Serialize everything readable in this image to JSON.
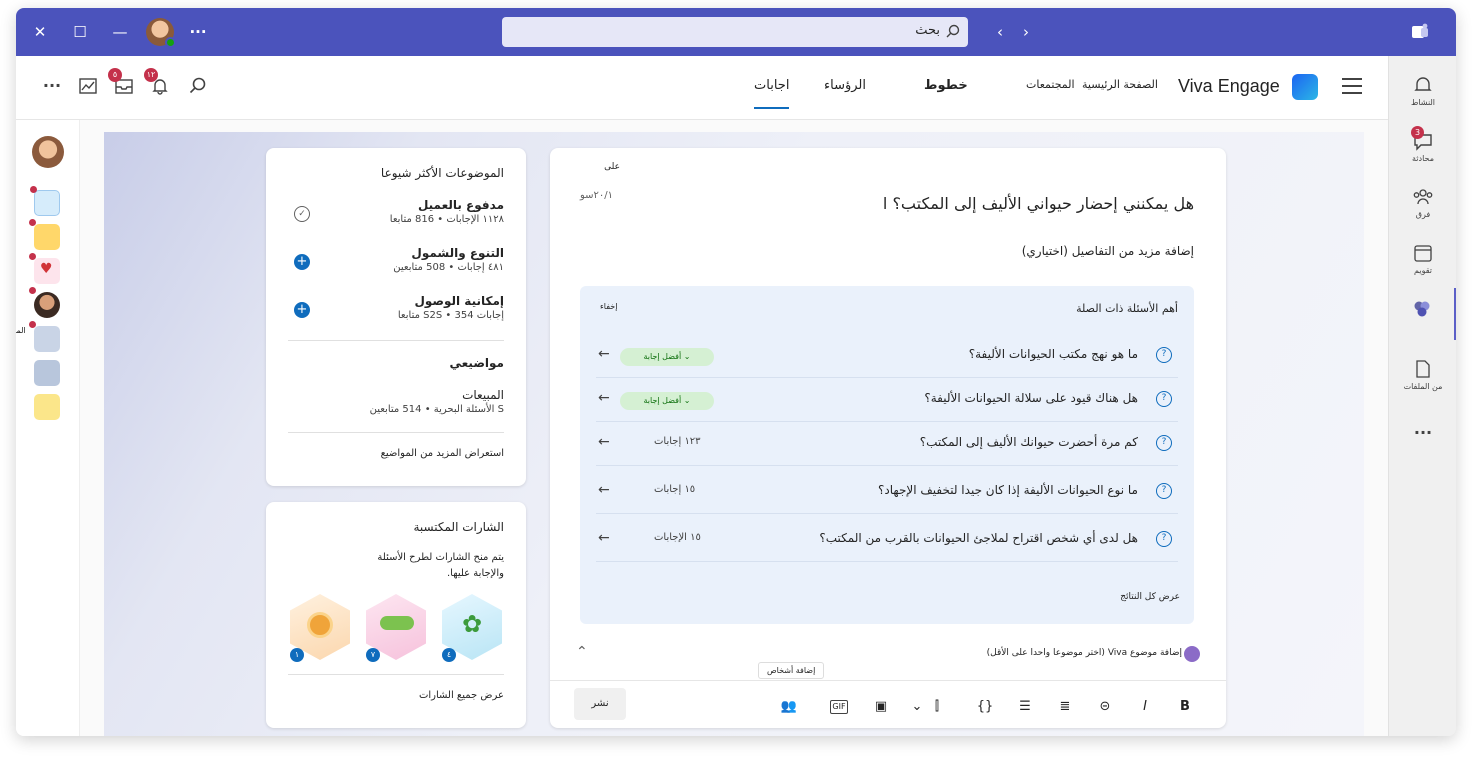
{
  "titlebar": {
    "search_label": "بحث",
    "more": "···"
  },
  "rail": [
    {
      "label": "النشاط",
      "icon": "bell-icon"
    },
    {
      "label": "محادثة",
      "icon": "chat-icon",
      "badge": "3"
    },
    {
      "label": "فرق",
      "icon": "teams-icon"
    },
    {
      "label": "تقويم",
      "icon": "calendar-icon"
    },
    {
      "label": "",
      "icon": "engage-icon"
    },
    {
      "label": "من الملفات",
      "icon": "file-icon"
    },
    {
      "label": "···",
      "icon": "more-icon"
    }
  ],
  "header": {
    "brand": "Viva Engage",
    "tabs": [
      "الصفحة الرئيسية",
      "المجتمعات",
      "خطوط",
      "الرؤساء",
      "اجابات"
    ],
    "badges": {
      "inbox": "٥",
      "bell": "١٢"
    }
  },
  "left_rail": {
    "tooltip": "المعارف"
  },
  "topics": {
    "title": "الموضوعات الأكثر شيوعا",
    "items": [
      {
        "name": "مدفوع بالعميل",
        "stats": "١١٢٨ الإجابات • 816 متابعا"
      },
      {
        "name": "التنوع والشمول",
        "stats": "٤٨١ إجابات • 508 متابعين"
      },
      {
        "name": "إمكانية الوصول",
        "stats": "إجابات 354 • S2S متابعا"
      }
    ],
    "mine_title": "مواضيعي",
    "mine_item": {
      "name": "المبيعات",
      "stats": "S الأسئلة البحرية • 514 متابعين"
    },
    "more": "استعراض المزيد من المواضيع"
  },
  "badges_card": {
    "title": "الشارات المكتسبة",
    "desc1": "يتم منح الشارات لطرح الأسئلة",
    "desc2": "والإجابة عليها.",
    "counts": [
      "٤",
      "٧",
      "١"
    ],
    "more": "عرض جميع الشارات"
  },
  "composer": {
    "to": "على",
    "counter": "٢٠/١سو",
    "title": "هل يمكنني إحضار حيواني الأليف إلى المكتب؟ ا",
    "details": "إضافة مزيد من التفاصيل (اختياري)",
    "related_title": "أهم الأسئلة ذات الصلة",
    "hide": "إخفاء",
    "questions": [
      {
        "q": "ما هو نهج مكتب الحيوانات الأليفة؟",
        "best": "أفضل إجابة",
        "count": ""
      },
      {
        "q": "هل هناك قيود على سلالة الحيوانات الأليفة؟",
        "best": "أفضل إجابة",
        "count": ""
      },
      {
        "q": "كم مرة أحضرت حيوانك الأليف إلى المكتب؟",
        "best": "",
        "count": "١٢٣ إجابات"
      },
      {
        "q": "ما نوع الحيوانات الأليفة إذا كان جيدا لتخفيف الإجهاد؟",
        "best": "",
        "count": "١٥ إجابات"
      },
      {
        "q": "هل لدى أي شخص اقتراح لملاجئ الحيوانات بالقرب من المكتب؟",
        "best": "",
        "count": "١٥ الإجابات"
      }
    ],
    "see_all": "عرض كل النتائج",
    "topic_prompt": "إضافة موضوع Viva (اختر موضوعا واحدا على الأقل)",
    "tooltip": "إضافة أشخاص",
    "post": "نشر",
    "gif": "GIF"
  }
}
